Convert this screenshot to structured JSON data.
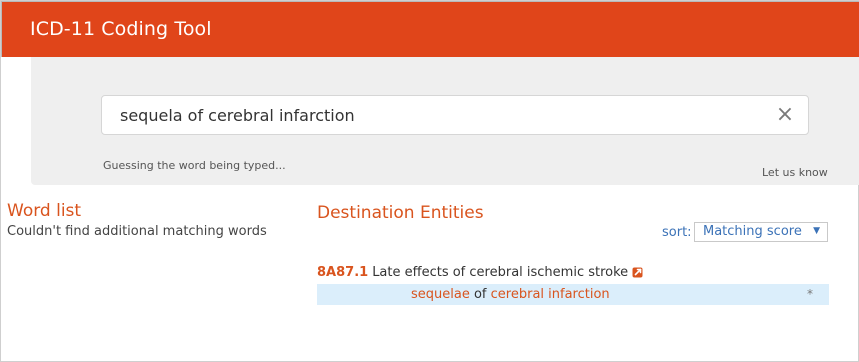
{
  "app": {
    "title": "ICD-11 Coding Tool"
  },
  "search": {
    "value": "sequela of cerebral infarction",
    "hint": "Guessing the word being typed...",
    "feedback": "Let us know"
  },
  "word_list": {
    "title": "Word list",
    "message": "Couldn't find additional matching words"
  },
  "destination": {
    "title": "Destination Entities",
    "sort_label": "sort:",
    "sort_value": "Matching score",
    "results": [
      {
        "code": "8A87.1",
        "title": "Late effects of cerebral ischemic stroke",
        "match": {
          "part1": "sequelae",
          "part2": " of ",
          "part3": "cerebral infarction",
          "marker": "*"
        }
      }
    ]
  },
  "icons": {
    "clear": "close-x-icon",
    "caret": "chevron-down-icon",
    "external": "external-link-icon"
  },
  "colors": {
    "header": "#e0451a",
    "accent": "#d9541e",
    "link": "#3b72b7",
    "highlight_row": "#dbeefb"
  }
}
